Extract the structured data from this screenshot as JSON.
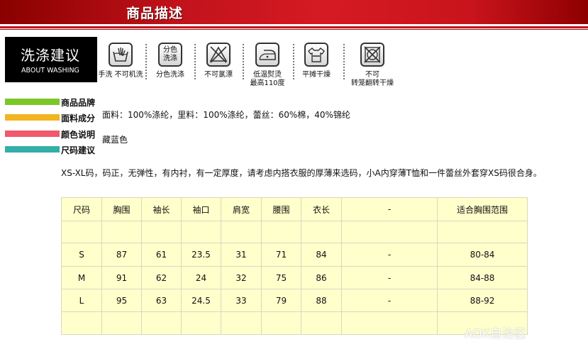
{
  "header": {
    "title": "商品描述"
  },
  "washing": {
    "title_cn": "洗涤建议",
    "title_en": "ABOUT WASHING",
    "icons": [
      {
        "name": "hand-wash-icon",
        "label": "手洗 不可机洗"
      },
      {
        "name": "separate-wash-icon",
        "icon_text": "分色\n洗涤",
        "label": "分色洗涤"
      },
      {
        "name": "no-bleach-icon",
        "label": "不可氯漂"
      },
      {
        "name": "low-temp-iron-icon",
        "label": "低温熨烫\n最高110度"
      },
      {
        "name": "dry-flat-icon",
        "label": "平摊干燥"
      },
      {
        "name": "no-tumble-dry-icon",
        "label": "不可\n转笼翻转干燥"
      }
    ]
  },
  "sections": {
    "brand": {
      "title": "商品品牌",
      "color": "#7cc728"
    },
    "material": {
      "title": "面料成分",
      "color": "#f2b51f",
      "value": "面料：100%涤纶，里料：100%涤纶，蕾丝：60%棉，40%锦纶"
    },
    "color": {
      "title": "颜色说明",
      "color": "#f15a6a",
      "value": "藏蓝色"
    },
    "size": {
      "title": "尺码建议",
      "color": "#33aea8",
      "note": "XS-XL码，码正，无弹性，有内衬，有一定厚度，请考虑内搭衣服的厚薄来选码，小A内穿薄T恤和一件蕾丝外套穿XS码很合身。"
    }
  },
  "size_table": {
    "headers": [
      "尺码",
      "胸围",
      "袖长",
      "袖口",
      "肩宽",
      "腰围",
      "衣长",
      "-",
      "适合胸围范围"
    ],
    "rows": [
      [
        "",
        "",
        "",
        "",
        "",
        "",
        "",
        "",
        ""
      ],
      [
        "S",
        "87",
        "61",
        "23.5",
        "31",
        "71",
        "84",
        "-",
        "80-84"
      ],
      [
        "M",
        "91",
        "62",
        "24",
        "32",
        "75",
        "86",
        "-",
        "84-88"
      ],
      [
        "L",
        "95",
        "63",
        "24.5",
        "33",
        "79",
        "88",
        "-",
        "88-92"
      ],
      [
        "",
        "",
        "",
        "",
        "",
        "",
        "",
        "",
        ""
      ]
    ]
  },
  "watermark": "AOK自治区"
}
